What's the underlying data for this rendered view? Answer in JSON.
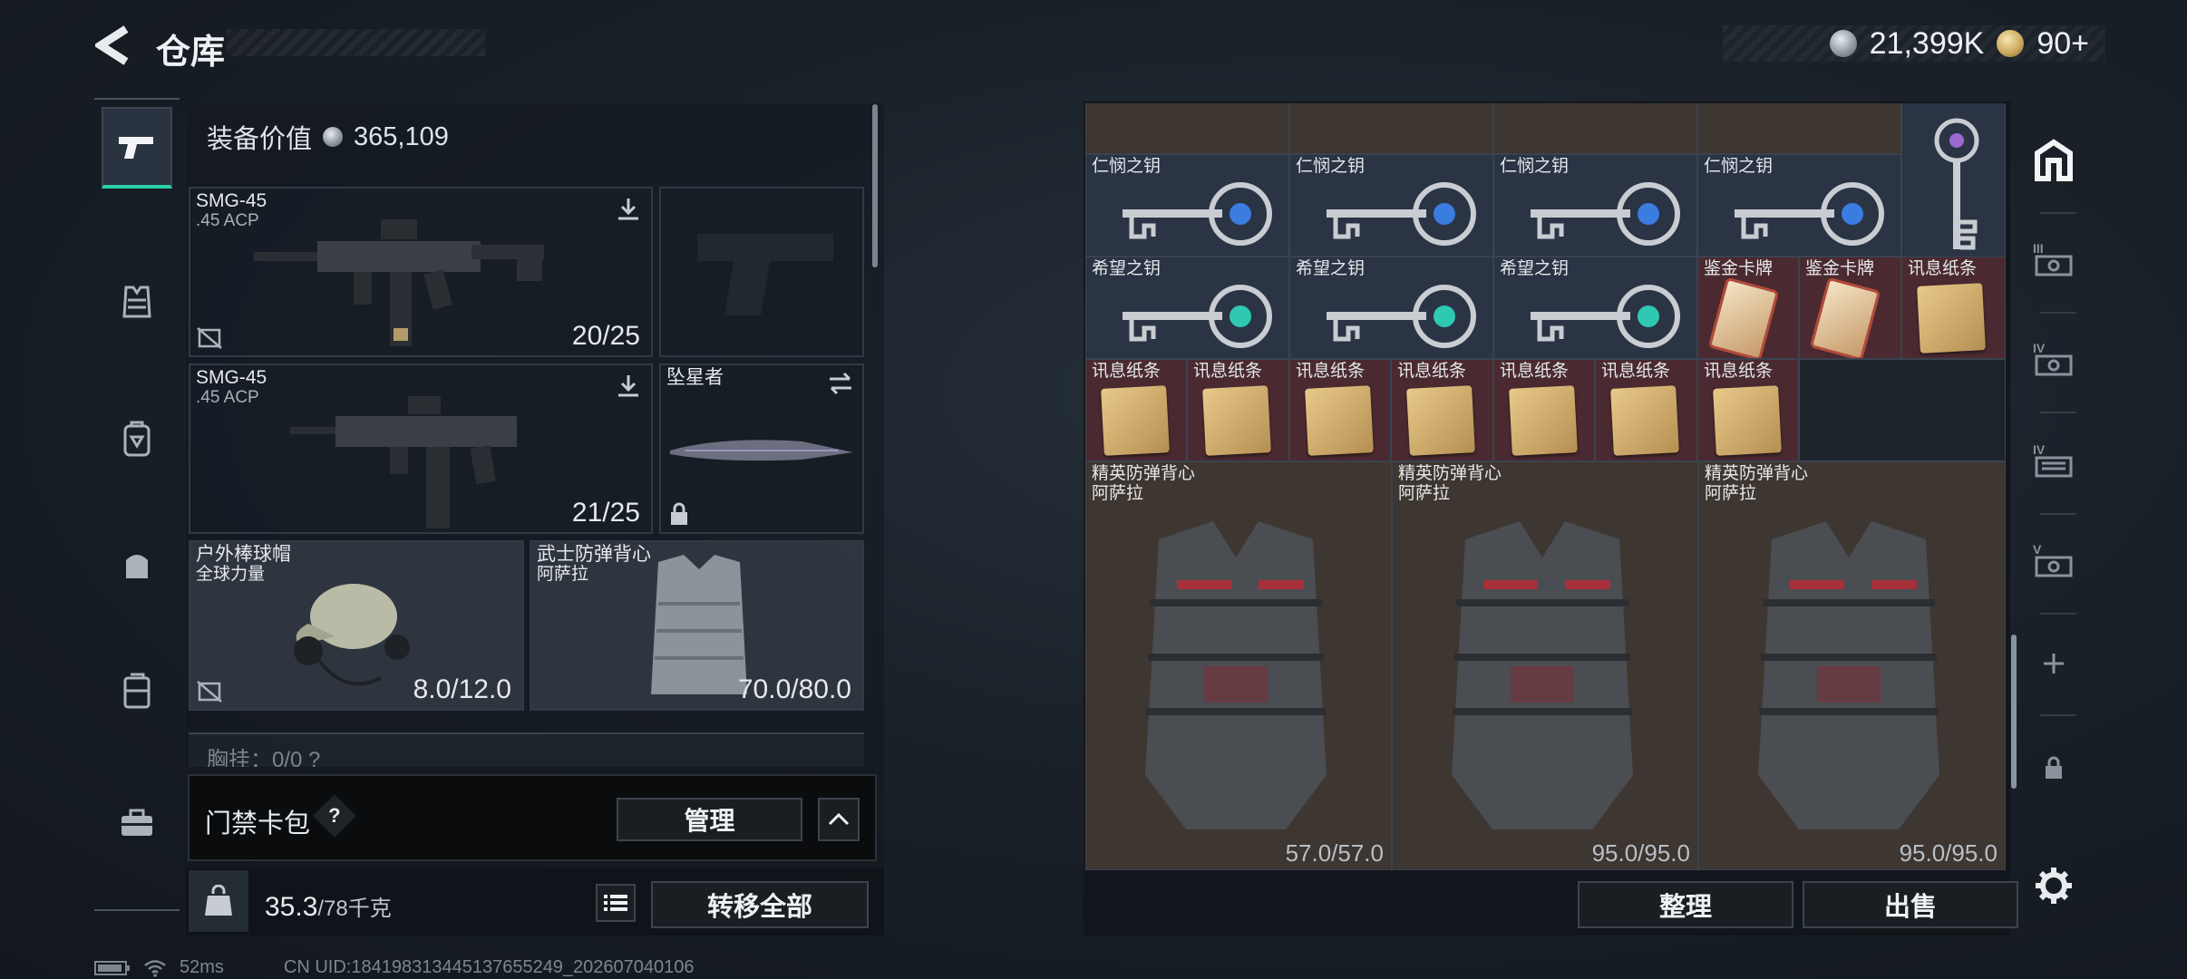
{
  "header": {
    "title": "仓库",
    "silver_amount": "21,399K",
    "gold_amount": "90+"
  },
  "loadout": {
    "equipment_value_label": "装备价值",
    "equipment_value": "365,109",
    "primary_weapon": {
      "name": "SMG-45",
      "ammo": ".45 ACP",
      "count": "20/25"
    },
    "secondary_weapon": {
      "name": "SMG-45",
      "ammo": ".45 ACP",
      "count": "21/25"
    },
    "melee": {
      "name": "坠星者"
    },
    "helmet": {
      "name": "户外棒球帽",
      "brand": "全球力量",
      "durability": "8.0/12.0"
    },
    "vest": {
      "name": "武士防弹背心",
      "brand": "阿萨拉",
      "durability": "70.0/80.0"
    },
    "chest_rig_label": "胸挂：0/0  ?"
  },
  "keycard": {
    "label": "门禁卡包",
    "help": "?",
    "manage": "管理"
  },
  "weight": {
    "current": "35.3",
    "max": "/78千克",
    "transfer_all": "转移全部"
  },
  "status": {
    "ping": "52ms",
    "uid": "CN UID:184198313445137655249_202607040106"
  },
  "stash": {
    "keys_row_compassion": [
      "仁悯之钥",
      "仁悯之钥",
      "仁悯之钥",
      "仁悯之钥"
    ],
    "keys_row_hope": [
      "希望之钥",
      "希望之钥",
      "希望之钥"
    ],
    "appraisal_card": [
      "鉴金卡牌",
      "鉴金卡牌"
    ],
    "note_label": "讯息纸条",
    "vests": [
      {
        "name": "精英防弹背心",
        "brand": "阿萨拉",
        "durability": "57.0/57.0"
      },
      {
        "name": "精英防弹背心",
        "brand": "阿萨拉",
        "durability": "95.0/95.0"
      },
      {
        "name": "精英防弹背心",
        "brand": "阿萨拉",
        "durability": "95.0/95.0"
      }
    ],
    "sort_label": "整理",
    "sell_label": "出售"
  },
  "right_tabs": [
    "home-tab",
    "tab-III",
    "tab-IV",
    "tab-IV-2",
    "tab-V",
    "add-tab",
    "lock-tab",
    "settings"
  ]
}
